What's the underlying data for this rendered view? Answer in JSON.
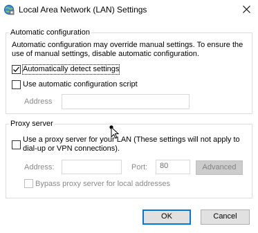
{
  "window": {
    "title": "Local Area Network (LAN) Settings",
    "icon": "network-settings-icon",
    "close_icon": "close-icon"
  },
  "automatic_configuration": {
    "group_title": "Automatic configuration",
    "description_line1": "Automatic configuration may override manual settings.  To ensure the",
    "description_line2": "use of manual settings, disable automatic configuration.",
    "auto_detect": {
      "label": "Automatically detect settings",
      "checked": true
    },
    "use_script": {
      "label": "Use automatic configuration script",
      "checked": false
    },
    "address_label": "Address",
    "address_value": ""
  },
  "proxy_server": {
    "group_title": "Proxy server",
    "use_proxy": {
      "label_line1": "Use a proxy server for your LAN (These settings will not apply to",
      "label_line2": "dial-up or VPN connections).",
      "checked": false
    },
    "address_label": "Address:",
    "address_value": "",
    "port_label": "Port:",
    "port_value": "80",
    "advanced_label": "Advanced",
    "bypass": {
      "label": "Bypass proxy server for local addresses",
      "checked": false
    }
  },
  "buttons": {
    "ok": "OK",
    "cancel": "Cancel"
  },
  "colors": {
    "accent": "#0078d7",
    "group_border": "#dcdcdc",
    "disabled_text": "#8a8a8a"
  }
}
